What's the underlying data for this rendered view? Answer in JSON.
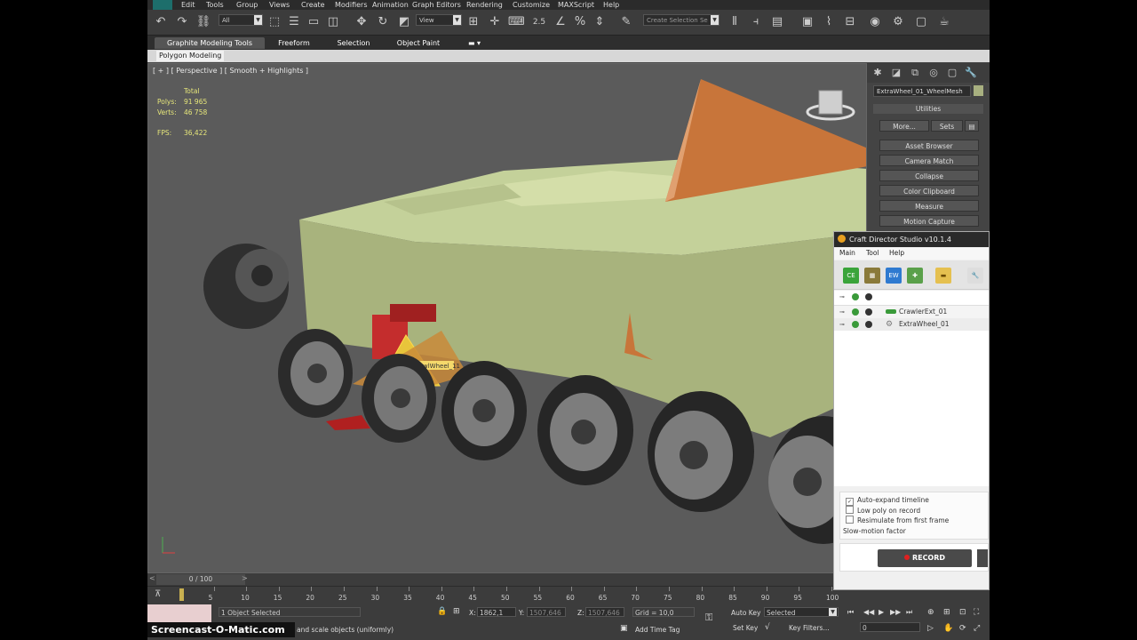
{
  "menubar": {
    "items": [
      "Edit",
      "Tools",
      "Group",
      "Views",
      "Create",
      "Modifiers",
      "Animation",
      "Graph Editors",
      "Rendering",
      "Customize",
      "MAXScript",
      "Help"
    ]
  },
  "toolbar": {
    "selection_filter": "All",
    "reference_coord": "View",
    "snap_value": "2.5",
    "selection_set_placeholder": "Create Selection Se"
  },
  "ribbon": {
    "tabs": [
      "Graphite Modeling Tools",
      "Freeform",
      "Selection",
      "Object Paint"
    ],
    "active_tab": "Graphite Modeling Tools",
    "panel_label": "Polygon Modeling"
  },
  "viewport": {
    "label": "[ + ] [ Perspective ] [ Smooth + Highlights ]",
    "stats": {
      "total_label": "Total",
      "polys_label": "Polys:",
      "polys_value": "91 965",
      "verts_label": "Verts:",
      "verts_value": "46 758",
      "fps_label": "FPS:",
      "fps_value": "36,422"
    },
    "gizmo_label": "rowlWheel_11"
  },
  "command_panel": {
    "object_name": "ExtraWheel_01_WheelMesh",
    "object_color": "#a8b080",
    "rollout_title": "Utilities",
    "more_button": "More...",
    "sets_button": "Sets",
    "utilities": [
      "Asset Browser",
      "Camera Match",
      "Collapse",
      "Color Clipboard",
      "Measure",
      "Motion Capture"
    ]
  },
  "timeline": {
    "frame_display": "0 / 100",
    "ticks": [
      "5",
      "10",
      "15",
      "20",
      "25",
      "30",
      "35",
      "40",
      "45",
      "50",
      "55",
      "60",
      "65",
      "70",
      "75",
      "80",
      "85",
      "90",
      "95",
      "100"
    ]
  },
  "statusbar": {
    "selection_status": "1 Object Selected",
    "prompt": "and scale objects (uniformly)",
    "x_label": "X:",
    "x_value": "1862,1",
    "y_label": "Y:",
    "y_value": "1507,646",
    "z_label": "Z:",
    "z_value": "1507,646",
    "grid": "Grid = 10,0",
    "add_time_tag": "Add Time Tag",
    "auto_key": "Auto Key",
    "set_key": "Set Key",
    "key_mode": "Selected",
    "key_filters": "Key Filters...",
    "current_frame": "0"
  },
  "craft_director": {
    "title": "Craft Director Studio v10.1.4",
    "menu": [
      "Main",
      "Tool",
      "Help"
    ],
    "tools": [
      "CE",
      "EW"
    ],
    "rows": [
      {
        "label": ""
      },
      {
        "label": "CrawlerExt_01"
      },
      {
        "label": "ExtraWheel_01"
      }
    ],
    "options": [
      {
        "label": "Auto-expand timeline",
        "checked": true
      },
      {
        "label": "Low poly on record",
        "checked": false
      },
      {
        "label": "Resimulate from first frame",
        "checked": false
      }
    ],
    "slowmotion_label": "Slow-motion factor",
    "record_button": "RECORD"
  },
  "watermark": "Screencast-O-Matic.com",
  "colors": {
    "hull": "#b3c08a",
    "viewport_bg": "#5b5b5b",
    "accent_orange": "#c8753a",
    "wheel": "#3a3a3a",
    "stats_text": "#e6e67a"
  }
}
